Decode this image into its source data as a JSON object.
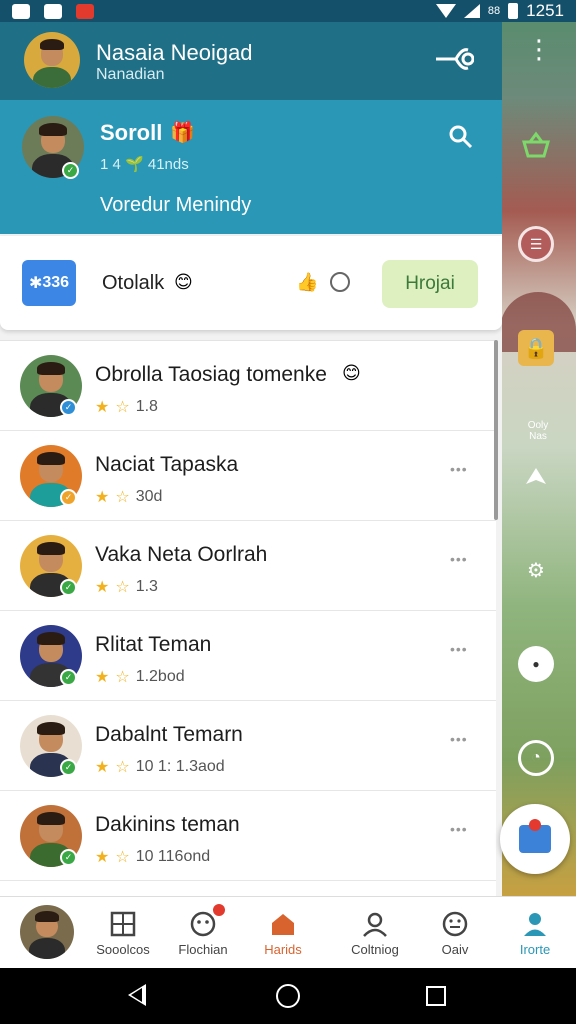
{
  "status_bar": {
    "time": "1251",
    "extra": "88"
  },
  "account": {
    "name": "Nasaia Neoigad",
    "subtitle": "Nanadian"
  },
  "profile": {
    "name": "Soroll",
    "stats": "1 4  🌱  41nds",
    "status_text": "Voredur Menindy"
  },
  "card": {
    "badge": "336",
    "title": "Otolalk",
    "emoji": "😊",
    "button_label": "Hrojai"
  },
  "contacts": [
    {
      "name": "Obrolla Taosiag tomenke",
      "emoji": "😊",
      "meta": "1.8",
      "badge_color": "#2e8fd6",
      "avatar_bg": "#5b8a55",
      "shirt": "#2b2b2b"
    },
    {
      "name": "Naciat Tapaska",
      "meta": "30d",
      "badge_color": "#f0a32b",
      "avatar_bg": "#e07b2a",
      "shirt": "#1d9e9a"
    },
    {
      "name": "Vaka Neta Oorlrah",
      "meta": "1.3",
      "badge_color": "#3aa845",
      "avatar_bg": "#e6b040",
      "shirt": "#2d2d2d"
    },
    {
      "name": "Rlitat Teman",
      "meta": "1.2bod",
      "badge_color": "#3aa845",
      "avatar_bg": "#2e3a8a",
      "shirt": "#333"
    },
    {
      "name": "Dabalnt Temarn",
      "meta": "10 1: 1.3aod",
      "badge_color": "#3aa845",
      "avatar_bg": "#e8dfd2",
      "shirt": "#2a3350"
    },
    {
      "name": "Dakinins teman",
      "meta": "10 116ond",
      "badge_color": "#3aa845",
      "avatar_bg": "#c0713a",
      "shirt": "#3b6b2f"
    }
  ],
  "rail": {
    "label": "Ooly Nas"
  },
  "bottom_nav": [
    {
      "label": "Sooolcos",
      "icon": "grid-icon",
      "color": "#444"
    },
    {
      "label": "Flochian",
      "icon": "smiley-icon",
      "color": "#444"
    },
    {
      "label": "Harids",
      "icon": "home-icon",
      "color": "#d9632e"
    },
    {
      "label": "Coltniog",
      "icon": "person-icon",
      "color": "#444"
    },
    {
      "label": "Oaiv",
      "icon": "face-icon",
      "color": "#444"
    },
    {
      "label": "Irorte",
      "icon": "profile-icon",
      "color": "#2a97b6"
    }
  ]
}
